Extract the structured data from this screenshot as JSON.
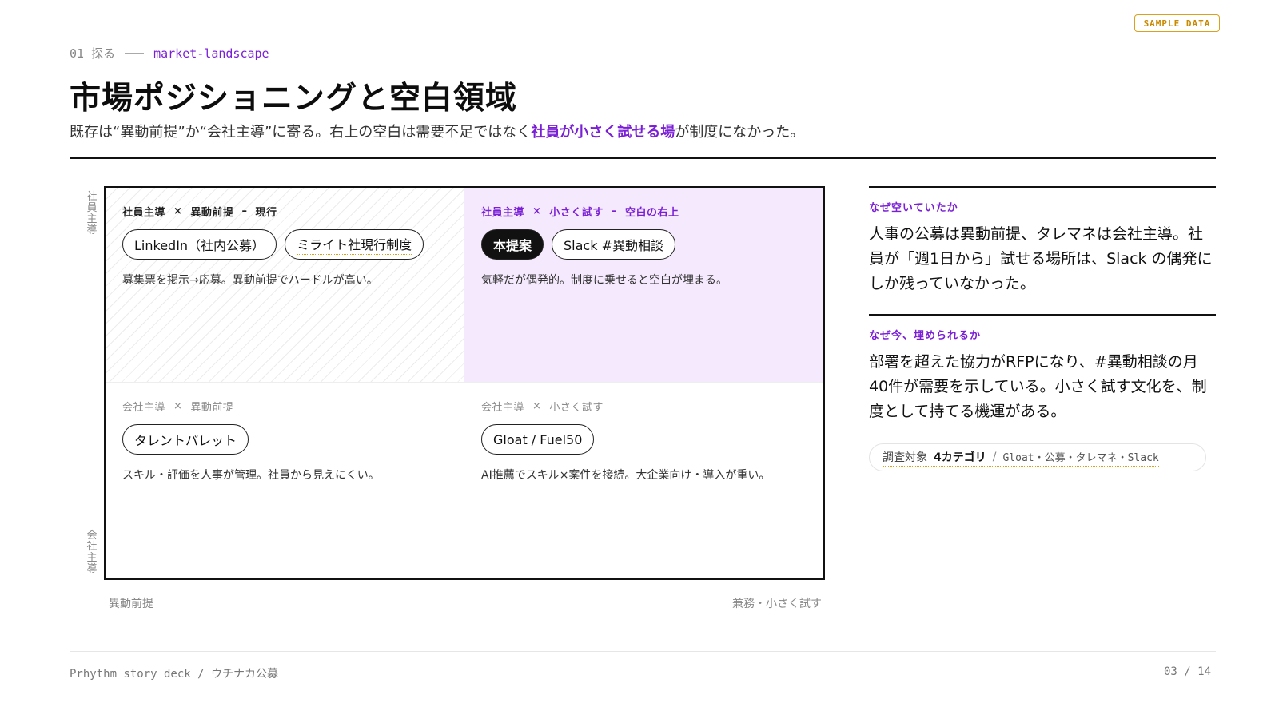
{
  "badge": "SAMPLE DATA",
  "eyebrow": {
    "number": "01 探る",
    "slug": "market-landscape"
  },
  "title": "市場ポジショニングと空白領域",
  "subtitle": {
    "before": "既存は“異動前提”か“会社主導”に寄る。右上の空白は需要不足ではなく",
    "highlight": "社員が小さく試せる場",
    "after": "が制度になかった。"
  },
  "axes": {
    "y_top": "社員主導",
    "y_bottom": "会社主導",
    "x_left": "異動前提",
    "x_right": "兼務・小さく試す"
  },
  "quadrants": {
    "top_left": {
      "label_a": "社員主導",
      "label_b": "異動前提",
      "label_note": "現行",
      "pill_1": "LinkedIn（社内公募）",
      "pill_2": "ミライト社現行制度",
      "desc": "募集票を掲示→応募。異動前提でハードルが高い。"
    },
    "top_right": {
      "label_a": "社員主導",
      "label_b": "小さく試す",
      "label_note": "空白の右上",
      "pill_1": "本提案",
      "pill_2": "Slack #異動相談",
      "desc": "気軽だが偶発的。制度に乗せると空白が埋まる。"
    },
    "bottom_left": {
      "label_a": "会社主導",
      "label_b": "異動前提",
      "pill_1": "タレントパレット",
      "desc": "スキル・評価を人事が管理。社員から見えにくい。"
    },
    "bottom_right": {
      "label_a": "会社主導",
      "label_b": "小さく試す",
      "pill_1": "Gloat / Fuel50",
      "desc": "AI推薦でスキル×案件を接続。大企業向け・導入が重い。"
    }
  },
  "side": {
    "why_empty": {
      "label": "なぜ空いていたか",
      "body": "人事の公募は異動前提、タレマネは会社主導。社員が「週1日から」試せる場所は、Slack の偶発にしか残っていなかった。"
    },
    "why_now": {
      "label": "なぜ今、埋められるか",
      "body": "部署を超えた協力がRFPになり、#異動相談の月40件が需要を示している。小さく試す文化を、制度として持てる機運がある。"
    }
  },
  "survey_note": {
    "label": "調査対象",
    "count": "4カテゴリ",
    "categories": "Gloat・公募・タレマネ・Slack"
  },
  "footer": {
    "left": "Prhythm story deck / ウチナカ公募",
    "right": "03 / 14"
  },
  "colors": {
    "accent": "#7a1fd6",
    "accent_bg": "#f5eafd",
    "badge": "#d9a11e",
    "ink": "#111111"
  }
}
